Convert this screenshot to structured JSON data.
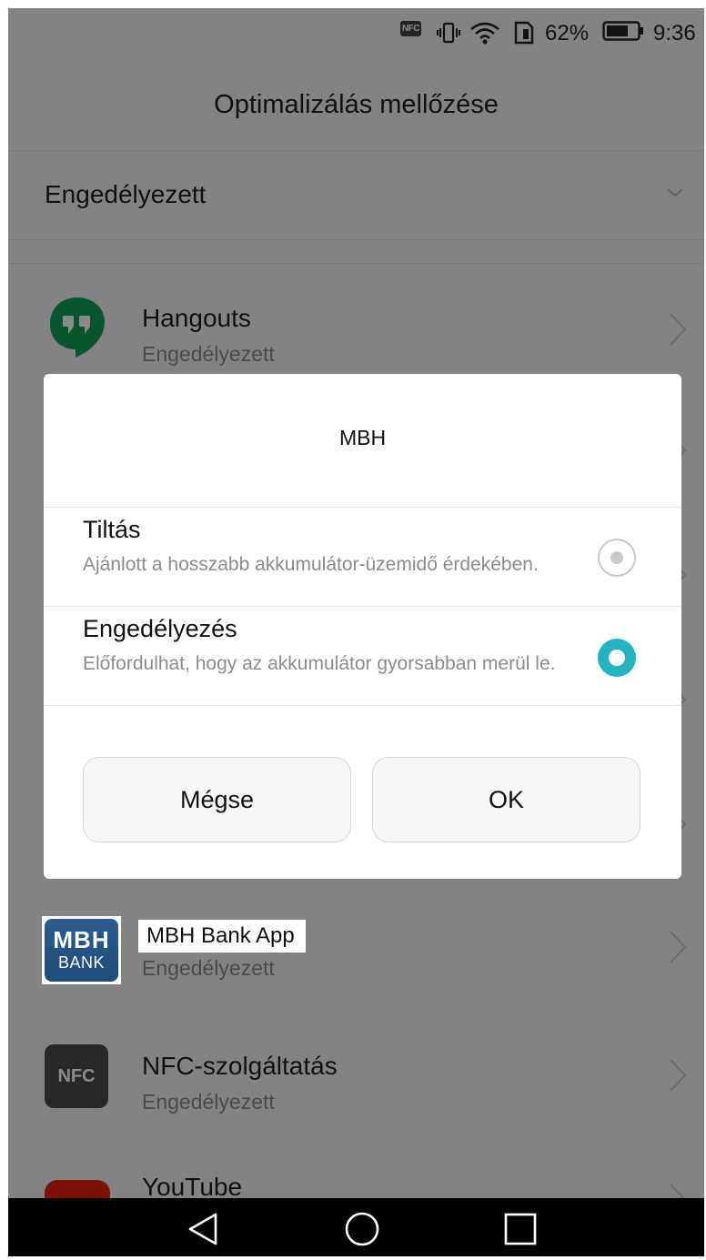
{
  "status_bar": {
    "nfc_label": "NFC",
    "battery_percent": "62%",
    "time": "9:36"
  },
  "header": {
    "title": "Optimalizálás mellőzése"
  },
  "filter": {
    "label": "Engedélyezett"
  },
  "apps": [
    {
      "name": "Hangouts",
      "status": "Engedélyezett",
      "icon": "hangouts-icon"
    },
    {
      "name": "MBH Bank App",
      "status": "Engedélyezett",
      "icon": "mbh-bank-icon"
    },
    {
      "name": "NFC-szolgáltatás",
      "status": "Engedélyezett",
      "icon": "nfc-service-icon",
      "icon_text": "NFC"
    },
    {
      "name": "YouTube",
      "status": "",
      "icon": "youtube-icon"
    }
  ],
  "mbh_logo": {
    "line1": "MBH",
    "line2": "BANK"
  },
  "dialog": {
    "title": "MBH",
    "options": [
      {
        "title": "Tiltás",
        "description": "Ajánlott a hosszabb akkumulátor-üzemidő érdekében.",
        "selected": false
      },
      {
        "title": "Engedélyezés",
        "description": "Előfordulhat, hogy az akkumulátor gyorsabban merül le.",
        "selected": true
      }
    ],
    "cancel_label": "Mégse",
    "ok_label": "OK"
  },
  "colors": {
    "accent": "#26b3c0",
    "hangouts_green": "#0f9d58",
    "nfc_grey": "#4a4a4a",
    "youtube_red": "#e62117",
    "mbh_blue": "#24588b"
  }
}
